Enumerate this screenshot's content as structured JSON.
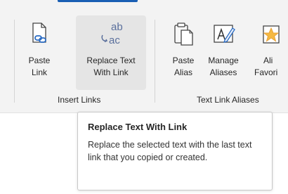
{
  "ribbon": {
    "buttons": [
      {
        "line1": "Paste",
        "line2": "Link",
        "icon": "paste-link-icon"
      },
      {
        "line1": "Replace Text",
        "line2": "With Link",
        "icon": "replace-text-icon"
      },
      {
        "line1": "Paste",
        "line2": "Alias",
        "icon": "paste-alias-icon"
      },
      {
        "line1": "Manage",
        "line2": "Aliases",
        "icon": "manage-aliases-icon"
      },
      {
        "line1": "Ali",
        "line2": "Favori",
        "icon": "alias-favorites-icon"
      }
    ],
    "groups": [
      {
        "label": "Insert Links"
      },
      {
        "label": "Text Link Aliases"
      }
    ],
    "replace_icon_text": {
      "top": "ab",
      "bottom": "ac"
    }
  },
  "tooltip": {
    "title": "Replace Text With Link",
    "body": "Replace the selected text with the last text link that you copied or created."
  },
  "colors": {
    "accent": "#1a5fb4",
    "icon_blue": "#2b6cc4",
    "icon_teal": "#1f8a86",
    "icon_orange": "#e8a33a",
    "ribbon_bg": "#f3f3f3",
    "hover_bg": "#e5e5e5"
  }
}
